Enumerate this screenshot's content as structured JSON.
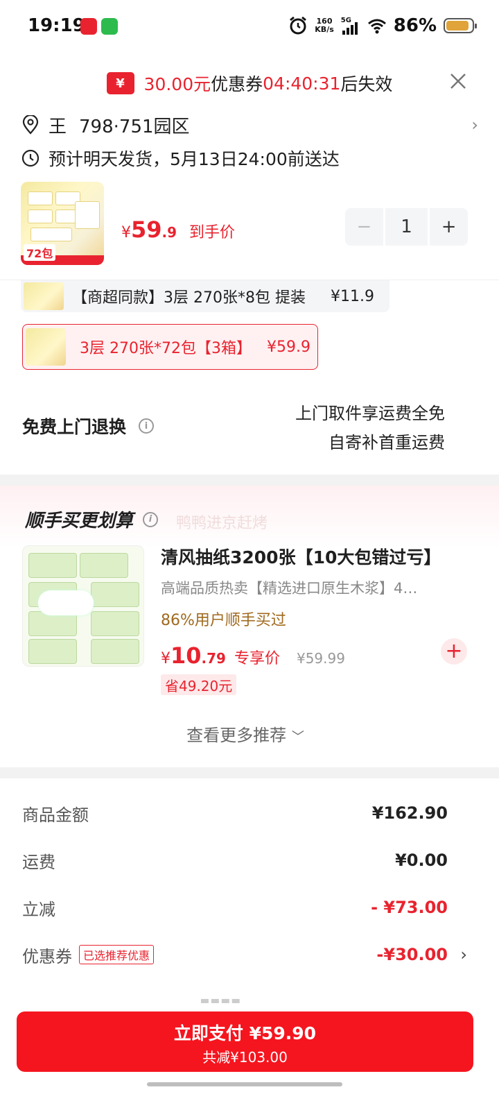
{
  "status_bar": {
    "time": "19:19",
    "net_speed_value": "160",
    "net_speed_unit": "KB/s",
    "network": "5G",
    "battery": "86%"
  },
  "coupon_banner": {
    "amount": "30.00元",
    "label": "优惠券",
    "countdown": "04:40:31",
    "suffix": "后失效",
    "tag_symbol": "¥"
  },
  "address": {
    "name": "王",
    "location": "798·751园区"
  },
  "delivery": {
    "text": "预计明天发货，5月13日24:00前送达"
  },
  "product": {
    "badge": "72包",
    "price_symbol": "¥",
    "price_int": "59",
    "price_dec": ".9",
    "price_label": "到手价",
    "quantity": "1",
    "minus": "−",
    "plus": "+"
  },
  "sku_options": [
    {
      "title": "【商超同款】3层 270张*8包 提装",
      "price": "¥11.9"
    },
    {
      "title": "3层 270张*72包【3箱】",
      "price": "¥59.9"
    }
  ],
  "return_service": {
    "title": "免费上门退换",
    "line1": "上门取件享运费全免",
    "line2": "自寄补首重运费"
  },
  "buy_together": {
    "title": "顺手买更划算",
    "subtitle": "鸭鸭进京赶烤",
    "item": {
      "title": "清风抽纸3200张【10大包错过亏】",
      "desc": "高端品质热卖【精选进口原生木浆】4…",
      "bought": "86%用户顺手买过",
      "price_symbol": "¥",
      "price_int": "10",
      "price_dec": ".79",
      "price_label": "专享价",
      "original_price": "¥59.99",
      "save": "省49.20元"
    },
    "more": "查看更多推荐"
  },
  "summary": {
    "goods_label": "商品金额",
    "goods_value": "¥162.90",
    "shipping_label": "运费",
    "shipping_value": "¥0.00",
    "discount_label": "立减",
    "discount_value": "- ¥73.00",
    "coupon_label": "优惠券",
    "coupon_tag": "已选推荐优惠",
    "coupon_value": "-¥30.00"
  },
  "pay_button": {
    "label": "立即支付 ¥59.90",
    "saved": "共减¥103.00"
  },
  "colors": {
    "accent_red": "#e8232f",
    "pay_red": "#f5151f",
    "buy_brown": "#a0691e"
  }
}
